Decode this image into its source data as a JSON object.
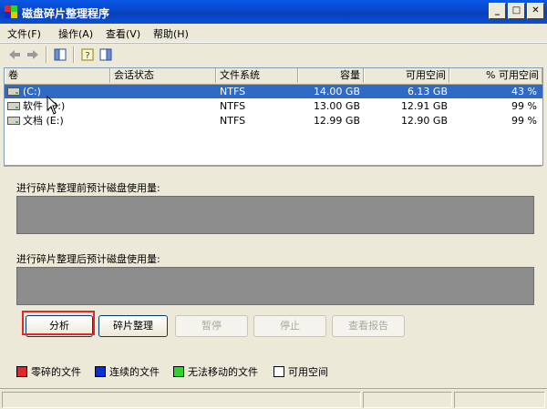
{
  "window": {
    "title": "磁盘碎片整理程序",
    "minimize": "_",
    "maximize": "□",
    "close": "✕"
  },
  "menu": [
    {
      "label": "文件(F)"
    },
    {
      "label": "操作(A)"
    },
    {
      "label": "查看(V)"
    },
    {
      "label": "帮助(H)"
    }
  ],
  "toolbar": {
    "icons": [
      "back-arrow-icon",
      "forward-arrow-icon",
      "properties-icon",
      "help-icon",
      "console-icon"
    ]
  },
  "columns": [
    "卷",
    "会话状态",
    "文件系统",
    "容量",
    "可用空间",
    "% 可用空间"
  ],
  "volumes": [
    {
      "name": "(C:)",
      "session": "",
      "fs": "NTFS",
      "capacity": "14.00 GB",
      "free": "6.13 GB",
      "pct": "43 %",
      "selected": true
    },
    {
      "name": "软件 (D:)",
      "session": "",
      "fs": "NTFS",
      "capacity": "13.00 GB",
      "free": "12.91 GB",
      "pct": "99 %",
      "selected": false
    },
    {
      "name": "文档 (E:)",
      "session": "",
      "fs": "NTFS",
      "capacity": "12.99 GB",
      "free": "12.90 GB",
      "pct": "99 %",
      "selected": false
    }
  ],
  "before_label": "进行碎片整理前预计磁盘使用量:",
  "after_label": "进行碎片整理后预计磁盘使用量:",
  "buttons": {
    "analyze": "分析",
    "defragment": "碎片整理",
    "pause": "暂停",
    "stop": "停止",
    "view_report": "查看报告"
  },
  "legend": [
    {
      "label": "零碎的文件",
      "color": "#e4262b"
    },
    {
      "label": "连续的文件",
      "color": "#0a2fd8"
    },
    {
      "label": "无法移动的文件",
      "color": "#2dd42d"
    },
    {
      "label": "可用空间",
      "color": "#ffffff"
    }
  ]
}
